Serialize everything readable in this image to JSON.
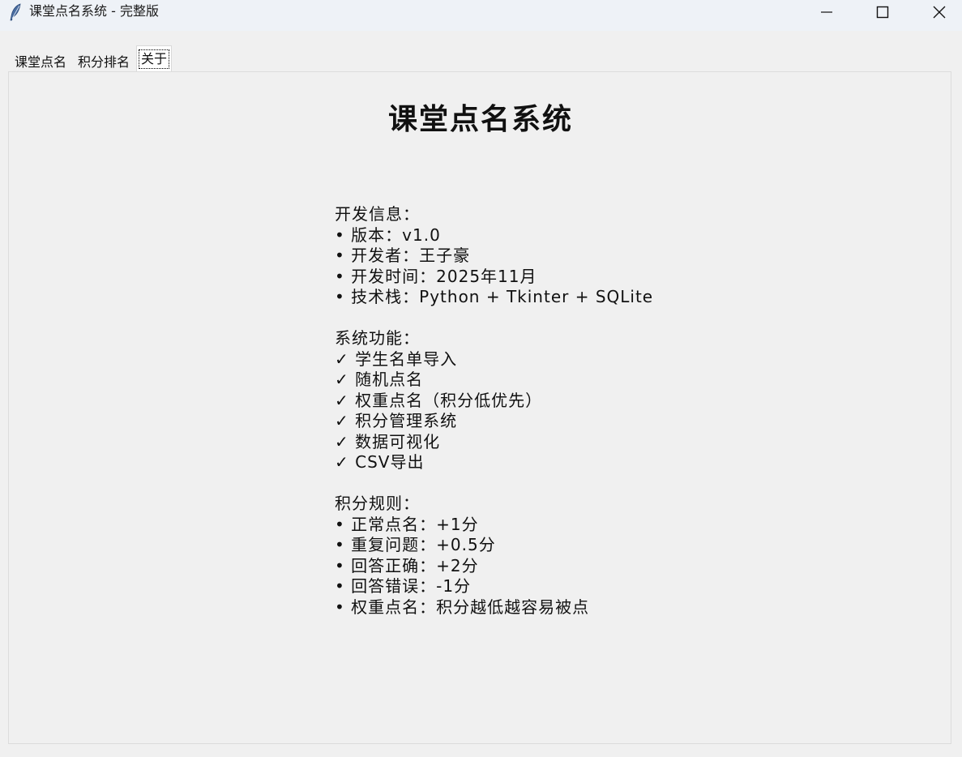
{
  "window": {
    "title": "课堂点名系统 - 完整版",
    "icon": "feather-icon"
  },
  "tabs": [
    {
      "label": "课堂点名",
      "active": false
    },
    {
      "label": "积分排名",
      "active": false
    },
    {
      "label": "关于",
      "active": true
    }
  ],
  "about": {
    "title": "课堂点名系统",
    "dev_heading": "开发信息：",
    "dev_lines": [
      "• 版本：v1.0",
      "• 开发者：王子豪",
      "• 开发时间：2025年11月",
      "• 技术栈：Python + Tkinter + SQLite"
    ],
    "features_heading": "系统功能：",
    "features": [
      "✓ 学生名单导入",
      "✓ 随机点名",
      "✓ 权重点名（积分低优先）",
      "✓ 积分管理系统",
      "✓ 数据可视化",
      "✓ CSV导出"
    ],
    "rules_heading": "积分规则：",
    "rules": [
      "• 正常点名：+1分",
      "• 重复问题：+0.5分",
      "• 回答正确：+2分",
      "• 回答错误：-1分",
      "• 权重点名：积分越低越容易被点"
    ]
  }
}
